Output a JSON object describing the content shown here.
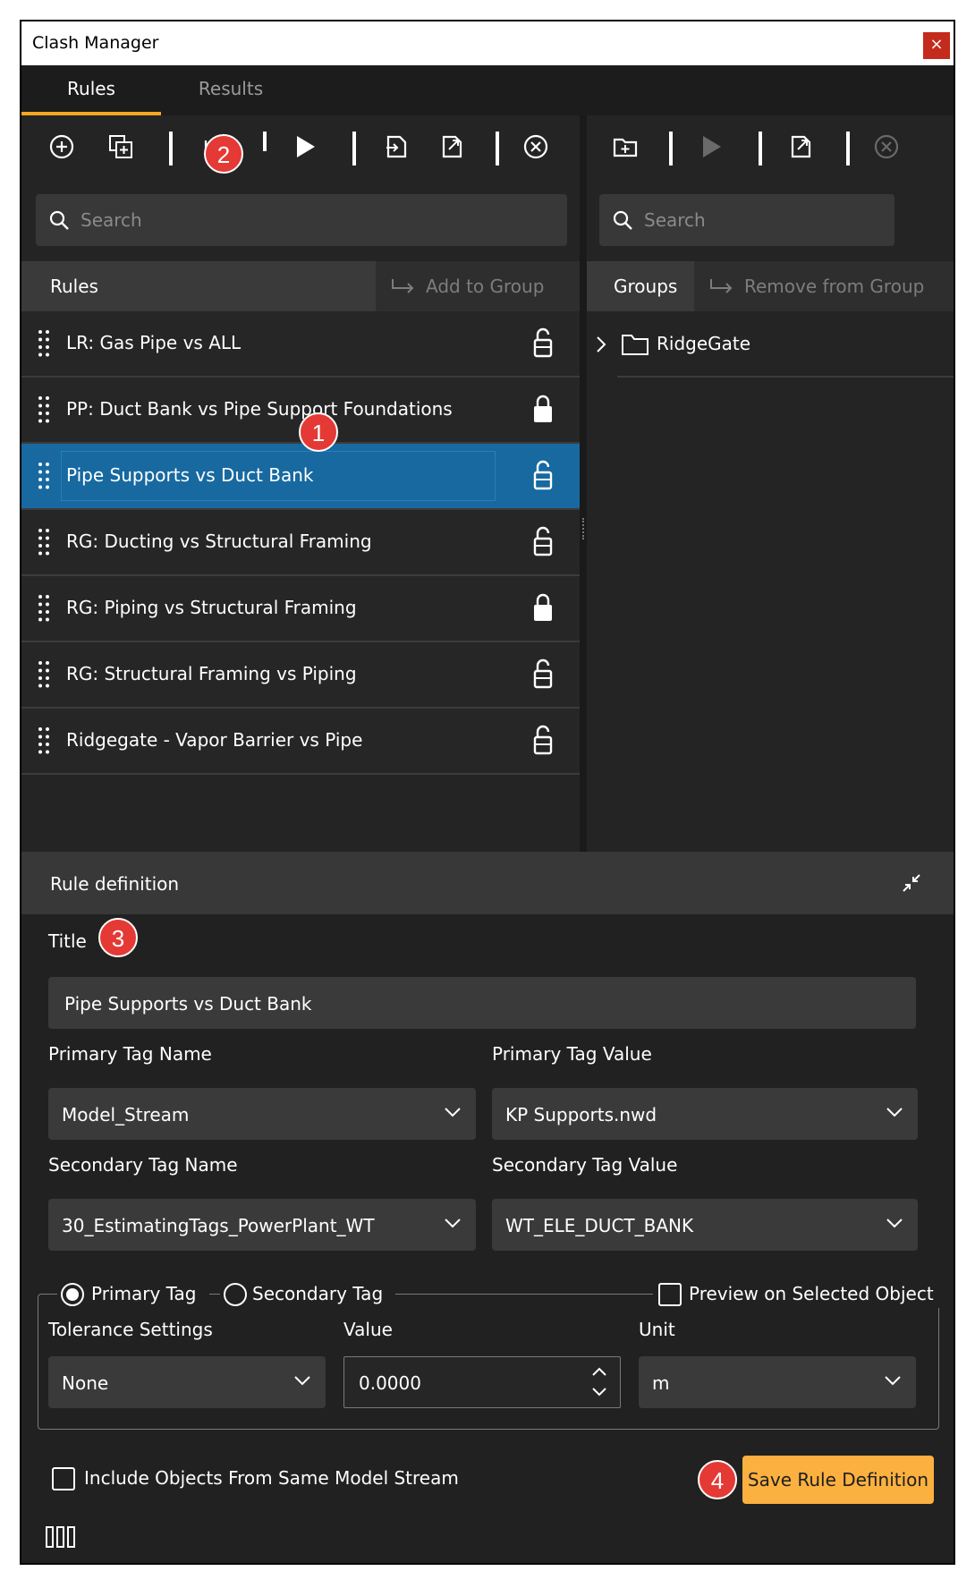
{
  "window": {
    "title": "Clash Manager",
    "close_label": "×"
  },
  "tabs": [
    {
      "label": "Rules"
    },
    {
      "label": "Results"
    }
  ],
  "left": {
    "search_placeholder": "Search",
    "header_label": "Rules",
    "add_to_group_label": "Add to Group",
    "rules": [
      {
        "label": "LR: Gas Pipe vs ALL",
        "locked": false
      },
      {
        "label": "PP: Duct Bank vs Pipe Support Foundations",
        "locked": true
      },
      {
        "label": "Pipe Supports vs Duct Bank",
        "locked": false,
        "selected": true
      },
      {
        "label": "RG: Ducting vs Structural Framing",
        "locked": false
      },
      {
        "label": "RG: Piping vs Structural Framing",
        "locked": true
      },
      {
        "label": "RG: Structural Framing vs Piping",
        "locked": false
      },
      {
        "label": "Ridgegate - Vapor Barrier vs Pipe",
        "locked": false
      }
    ]
  },
  "right": {
    "search_placeholder": "Search",
    "header_label": "Groups",
    "remove_from_group_label": "Remove from Group",
    "groups": [
      {
        "label": "RidgeGate"
      }
    ]
  },
  "badges": {
    "b1": "1",
    "b2": "2",
    "b3": "3",
    "b4": "4"
  },
  "definition": {
    "section_title": "Rule definition",
    "title_label": "Title",
    "title_value": "Pipe Supports vs Duct Bank",
    "primary_tag_name_label": "Primary Tag Name",
    "primary_tag_name_value": "Model_Stream",
    "primary_tag_value_label": "Primary Tag Value",
    "primary_tag_value_value": "KP Supports.nwd",
    "secondary_tag_name_label": "Secondary Tag Name",
    "secondary_tag_name_value": "30_EstimatingTags_PowerPlant_WT",
    "secondary_tag_value_label": "Secondary Tag Value",
    "secondary_tag_value_value": "WT_ELE_DUCT_BANK",
    "radio_primary": "Primary Tag",
    "radio_secondary": "Secondary Tag",
    "preview_label": "Preview on Selected Object",
    "tolerance_label": "Tolerance Settings",
    "tolerance_value": "None",
    "value_label": "Value",
    "value_value": "0.0000",
    "unit_label": "Unit",
    "unit_value": "m",
    "include_label": "Include Objects From Same Model Stream",
    "save_label": "Save Rule Definition"
  },
  "colors": {
    "accent": "#f5a623",
    "selected_row": "#1769a0",
    "save_button": "#fbb040",
    "badge": "#e53935"
  }
}
